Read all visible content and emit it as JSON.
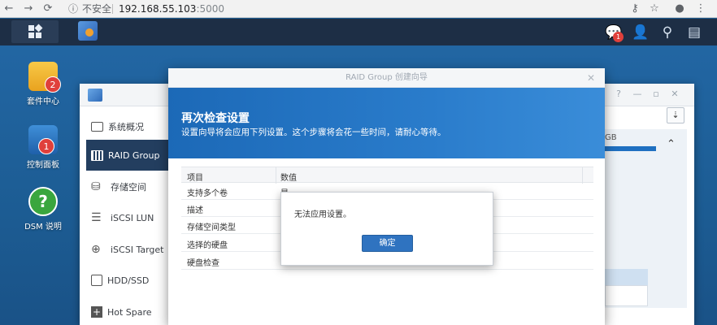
{
  "browser": {
    "back_icon": "back-arrow-icon",
    "forward_icon": "forward-arrow-icon",
    "reload_icon": "reload-icon",
    "security_label": "不安全",
    "url_host": "192.168.55.103",
    "url_port": ":5000"
  },
  "taskbar": {
    "notification_count": "1"
  },
  "desktop": {
    "icons": [
      {
        "label": "套件中心",
        "badge": "2"
      },
      {
        "label": "控制面板",
        "badge": "1"
      },
      {
        "label": "DSM 说明",
        "glyph": "?"
      }
    ]
  },
  "storage_window": {
    "sidebar": [
      {
        "label": "系统概况"
      },
      {
        "label": "RAID Group"
      },
      {
        "label": "存储空间"
      },
      {
        "label": "iSCSI LUN"
      },
      {
        "label": "iSCSI Target"
      },
      {
        "label": "HDD/SSD"
      },
      {
        "label": "Hot Spare"
      }
    ],
    "capacity_unit": "GB"
  },
  "wizard": {
    "title": "RAID Group 创建向导",
    "heading": "再次检查设置",
    "subtitle": "设置向导将会应用下列设置。这个步骤将会花一些时间，请耐心等待。",
    "columns": [
      "项目",
      "数值"
    ],
    "rows": [
      {
        "key": "支持多个卷",
        "value": "是"
      },
      {
        "key": "描述",
        "value": ""
      },
      {
        "key": "存储空间类型",
        "value": ""
      },
      {
        "key": "选择的硬盘",
        "value": ""
      },
      {
        "key": "硬盘检查",
        "value": ""
      }
    ]
  },
  "alert": {
    "message": "无法应用设置。",
    "ok_label": "确定"
  }
}
